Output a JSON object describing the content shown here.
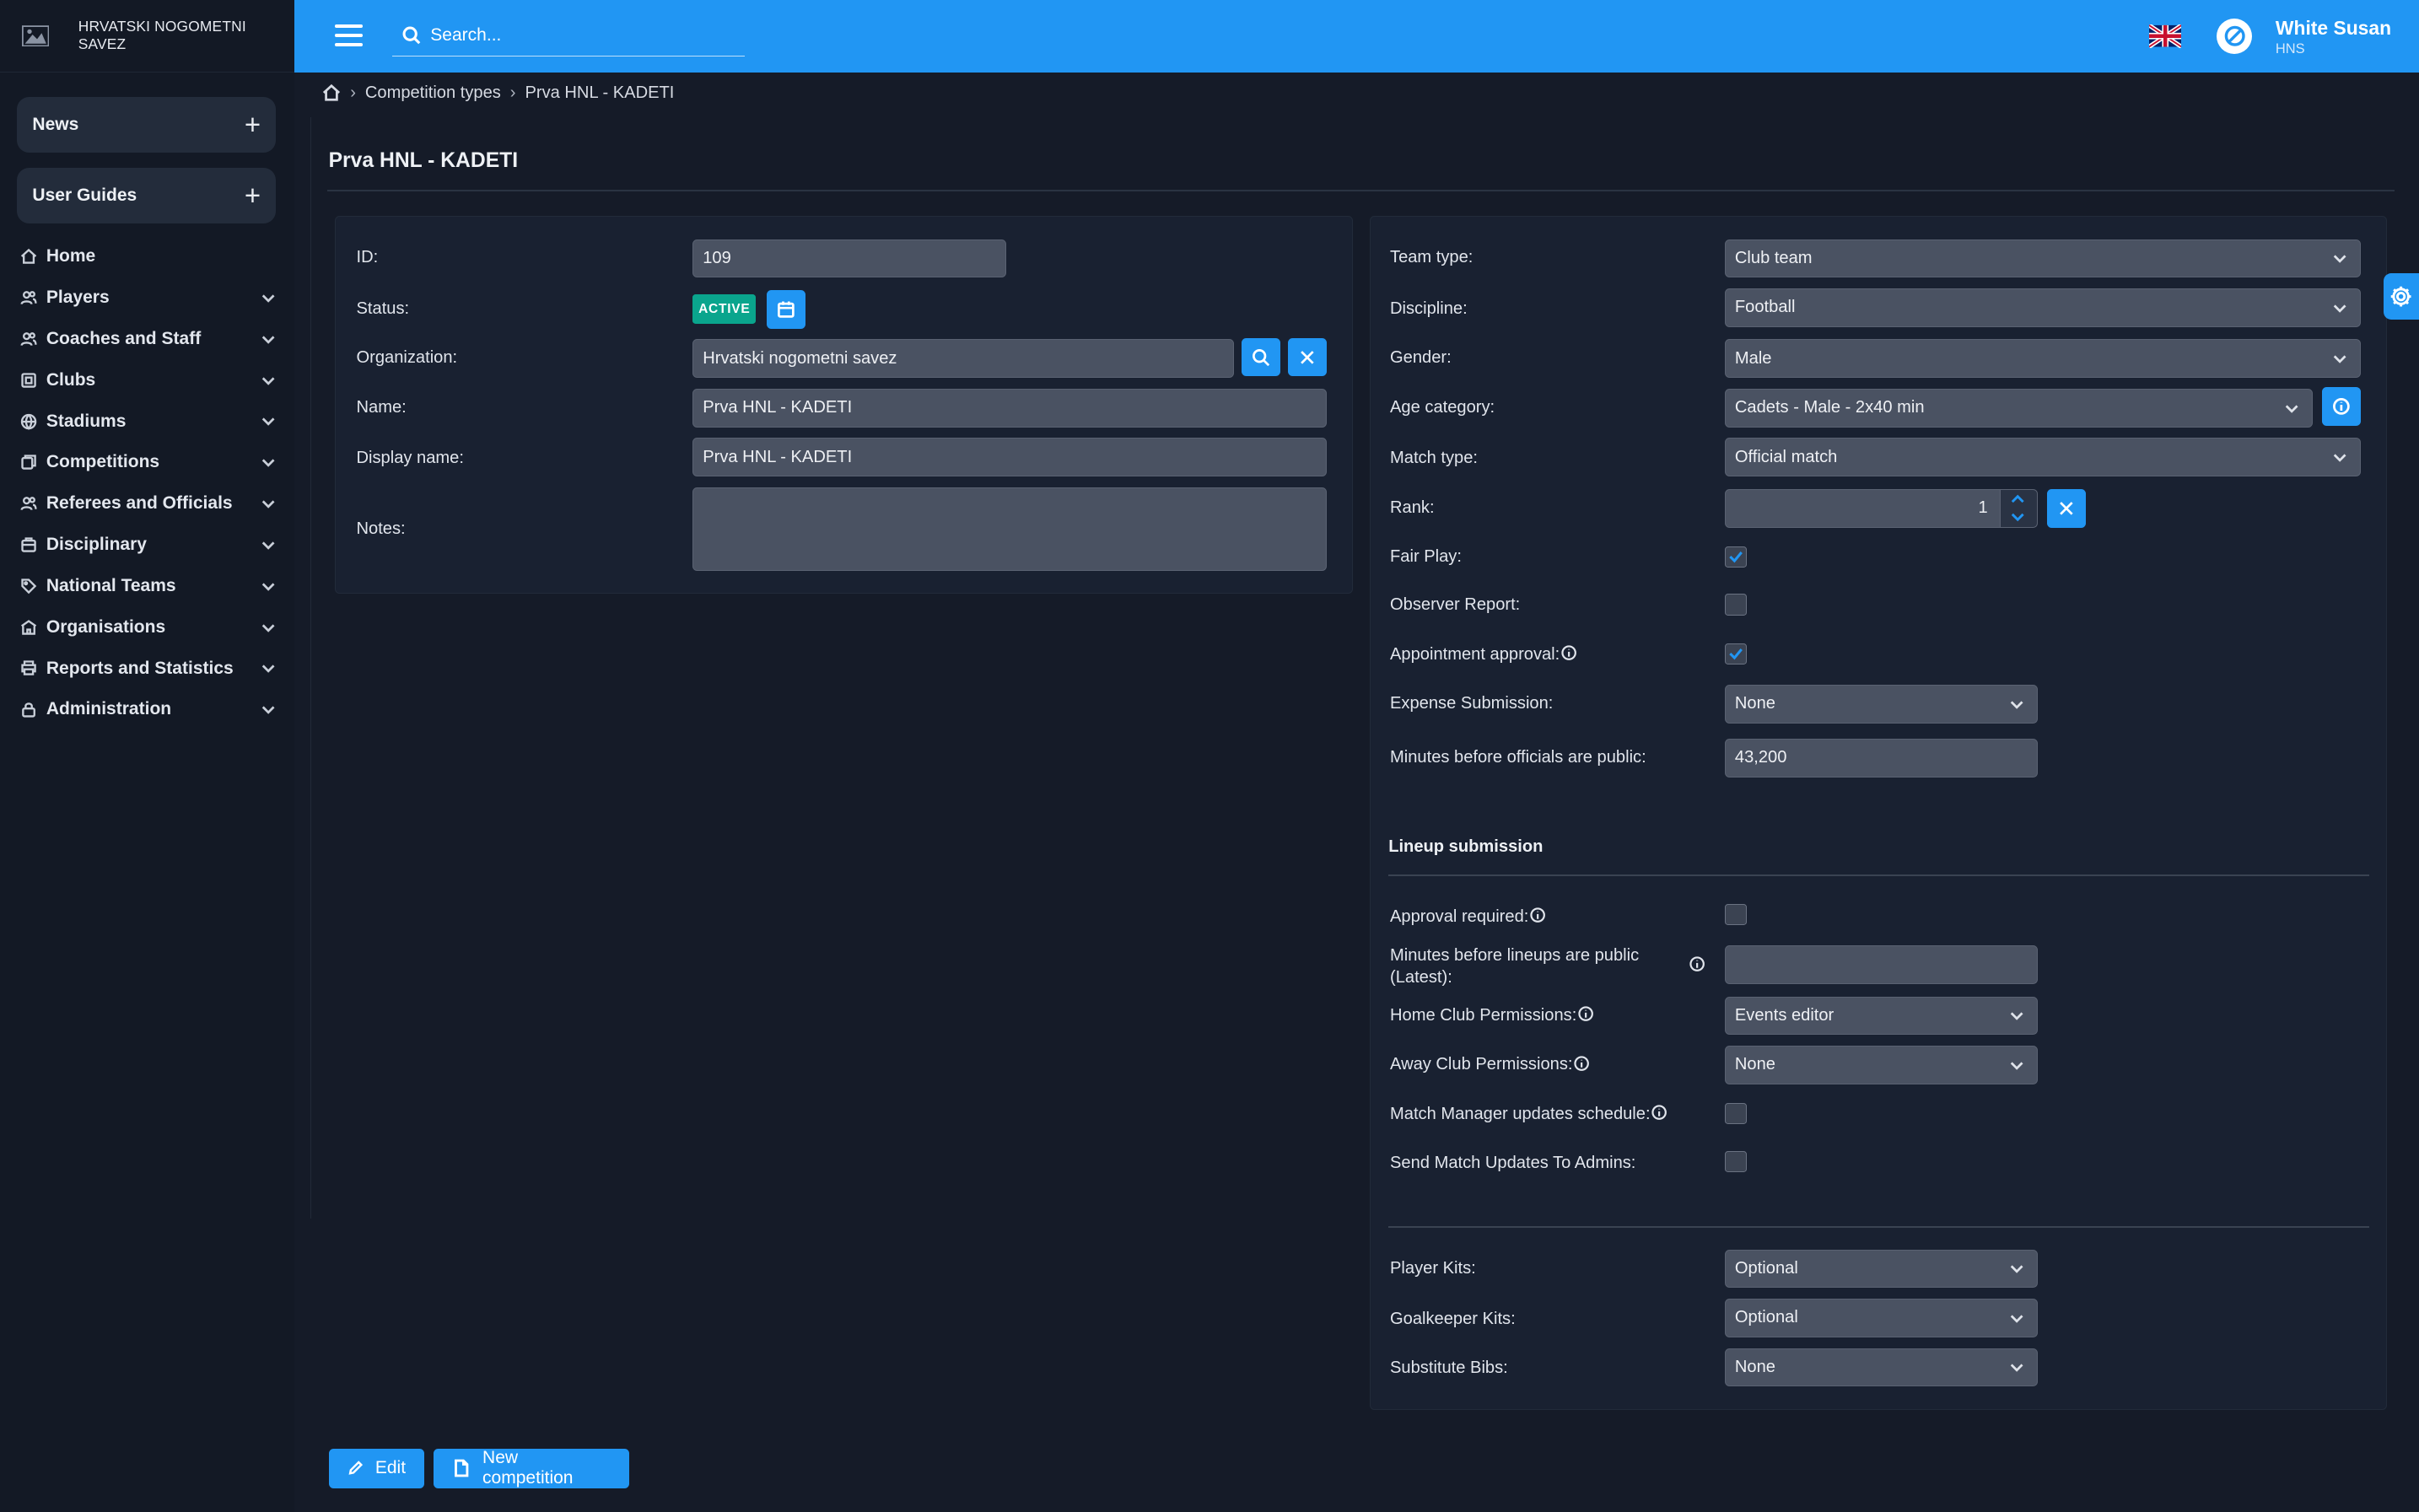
{
  "brand": {
    "name": "HRVATSKI NOGOMETNI SAVEZ"
  },
  "sidebar": {
    "collapsibles": [
      {
        "label": "News"
      },
      {
        "label": "User Guides"
      }
    ],
    "items": [
      {
        "label": "Home",
        "icon": "home-icon"
      },
      {
        "label": "Players",
        "icon": "players-icon"
      },
      {
        "label": "Coaches and Staff",
        "icon": "coaches-icon"
      },
      {
        "label": "Clubs",
        "icon": "clubs-icon"
      },
      {
        "label": "Stadiums",
        "icon": "globe-icon"
      },
      {
        "label": "Competitions",
        "icon": "competitions-icon"
      },
      {
        "label": "Referees and Officials",
        "icon": "referees-icon"
      },
      {
        "label": "Disciplinary",
        "icon": "disciplinary-icon"
      },
      {
        "label": "National Teams",
        "icon": "tag-icon"
      },
      {
        "label": "Organisations",
        "icon": "organisations-icon"
      },
      {
        "label": "Reports and Statistics",
        "icon": "print-icon"
      },
      {
        "label": "Administration",
        "icon": "lock-icon"
      }
    ]
  },
  "topbar": {
    "search_placeholder": "Search...",
    "user_name": "White Susan",
    "user_org": "HNS"
  },
  "breadcrumb": {
    "items": [
      "Competition types",
      "Prva HNL - KADETI"
    ]
  },
  "page": {
    "title": "Prva HNL - KADETI"
  },
  "left_form": {
    "id_label": "ID:",
    "id_value": "109",
    "status_label": "Status:",
    "status_value": "ACTIVE",
    "organization_label": "Organization:",
    "organization_value": "Hrvatski nogometni savez",
    "name_label": "Name:",
    "name_value": "Prva HNL - KADETI",
    "display_name_label": "Display name:",
    "display_name_value": "Prva HNL - KADETI",
    "notes_label": "Notes:",
    "notes_value": ""
  },
  "right_form": {
    "team_type_label": "Team type:",
    "team_type_value": "Club team",
    "discipline_label": "Discipline:",
    "discipline_value": "Football",
    "gender_label": "Gender:",
    "gender_value": "Male",
    "age_category_label": "Age category:",
    "age_category_value": "Cadets - Male - 2x40 min",
    "match_type_label": "Match type:",
    "match_type_value": "Official match",
    "rank_label": "Rank:",
    "rank_value": "1",
    "fair_play_label": "Fair Play:",
    "fair_play_checked": true,
    "observer_report_label": "Observer Report:",
    "observer_report_checked": false,
    "appointment_approval_label": "Appointment approval:",
    "appointment_approval_checked": true,
    "expense_submission_label": "Expense Submission:",
    "expense_submission_value": "None",
    "minutes_officials_label": "Minutes before officials are public:",
    "minutes_officials_value": "43,200",
    "lineup_section_title": "Lineup submission",
    "approval_required_label": "Approval required:",
    "approval_required_checked": false,
    "minutes_lineups_label_1": "Minutes before lineups are public",
    "minutes_lineups_label_2": "(Latest):",
    "minutes_lineups_value": "",
    "home_club_permissions_label": "Home Club Permissions:",
    "home_club_permissions_value": "Events editor",
    "away_club_permissions_label": "Away Club Permissions:",
    "away_club_permissions_value": "None",
    "match_manager_label": "Match Manager updates schedule:",
    "match_manager_checked": false,
    "send_match_updates_label": "Send Match Updates To Admins:",
    "send_match_updates_checked": false,
    "player_kits_label": "Player Kits:",
    "player_kits_value": "Optional",
    "goalkeeper_kits_label": "Goalkeeper Kits:",
    "goalkeeper_kits_value": "Optional",
    "substitute_bibs_label": "Substitute Bibs:",
    "substitute_bibs_value": "None"
  },
  "actions": {
    "edit_label": "Edit",
    "new_competition_label": "New competition"
  },
  "colors": {
    "accent": "#2196f3",
    "active_badge": "#0aa58d",
    "background": "#151b28"
  }
}
